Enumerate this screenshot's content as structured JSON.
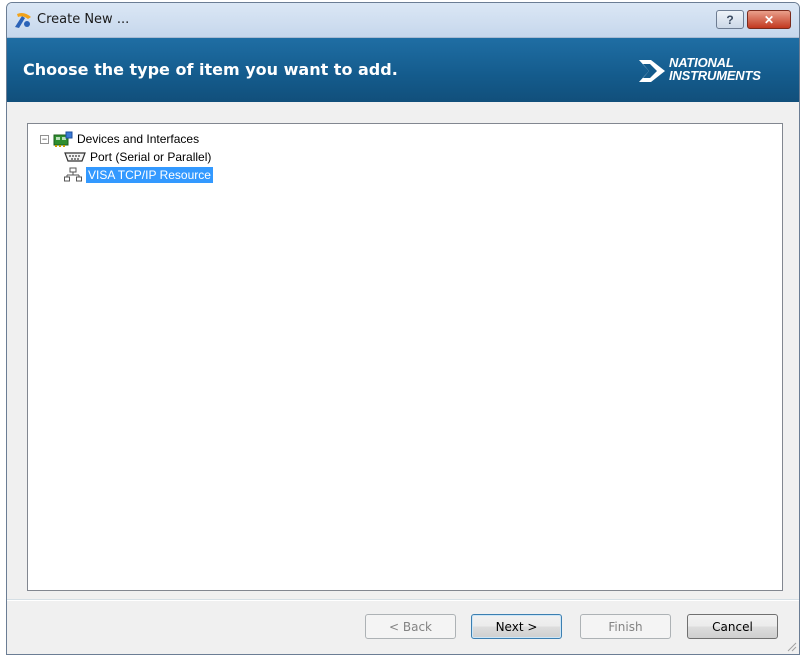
{
  "window": {
    "title": "Create New ...",
    "help_label": "?",
    "close_label": "✕"
  },
  "header": {
    "title": "Choose the type of item you want to add.",
    "logo_line1": "NATIONAL",
    "logo_line2": "INSTRUMENTS"
  },
  "tree": {
    "root": {
      "label": "Devices and Interfaces",
      "expanded": true,
      "expander_symbol": "−"
    },
    "children": [
      {
        "label": "Port (Serial or Parallel)",
        "icon": "serial-port-icon",
        "selected": false
      },
      {
        "label": "VISA TCP/IP Resource",
        "icon": "network-icon",
        "selected": true
      }
    ]
  },
  "buttons": {
    "back": "< Back",
    "next": "Next >",
    "finish": "Finish",
    "cancel": "Cancel"
  },
  "colors": {
    "header_blue": "#145b8c",
    "selection": "#3399ff"
  }
}
